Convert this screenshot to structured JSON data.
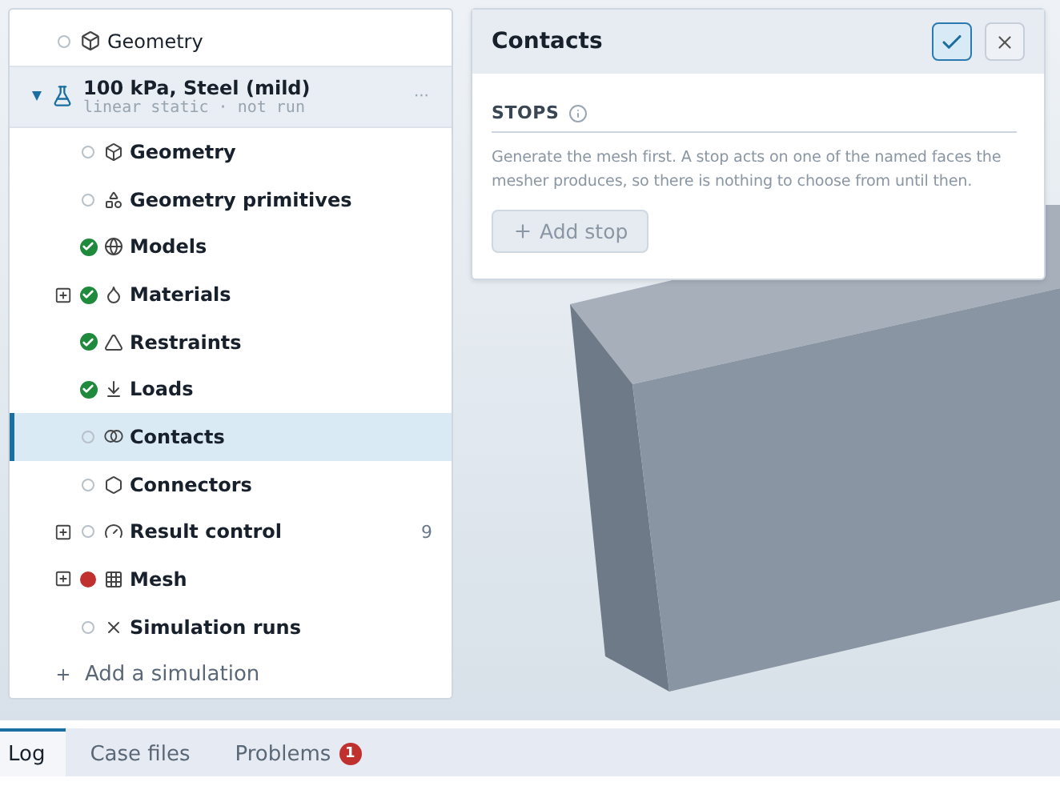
{
  "tree": {
    "top_items": [
      {
        "label": "Geometry",
        "complete": false,
        "failed": false
      }
    ],
    "simulation": {
      "title": "100 kPa, Steel (mild)",
      "subtitle": "linear static · not run",
      "expanded": true,
      "menu": "···",
      "children": [
        {
          "label": "Geometry",
          "complete": false,
          "failed": false,
          "expandable": false,
          "selected": false
        },
        {
          "label": "Geometry primitives",
          "complete": false,
          "failed": false,
          "expandable": false,
          "selected": false
        },
        {
          "label": "Models",
          "complete": true,
          "failed": false,
          "expandable": false,
          "selected": false
        },
        {
          "label": "Materials",
          "complete": true,
          "failed": false,
          "expandable": true,
          "selected": false
        },
        {
          "label": "Restraints",
          "complete": true,
          "failed": false,
          "expandable": false,
          "selected": false
        },
        {
          "label": "Loads",
          "complete": true,
          "failed": false,
          "expandable": false,
          "selected": false
        },
        {
          "label": "Contacts",
          "complete": false,
          "failed": false,
          "expandable": false,
          "selected": true
        },
        {
          "label": "Connectors",
          "complete": false,
          "failed": false,
          "expandable": false,
          "selected": false
        },
        {
          "label": "Result control",
          "complete": false,
          "failed": false,
          "expandable": true,
          "selected": false,
          "count": "9"
        },
        {
          "label": "Mesh",
          "complete": false,
          "failed": true,
          "expandable": true,
          "selected": false
        },
        {
          "label": "Simulation runs",
          "complete": false,
          "failed": false,
          "expandable": false,
          "selected": false
        }
      ]
    },
    "add_label": "Add a simulation"
  },
  "panel": {
    "title": "Contacts",
    "section": "STOPS",
    "description": "Generate the mesh first. A stop acts on one of the named faces the mesher produces, so there is nothing to choose from until then.",
    "add_button": {
      "label": "Add stop",
      "disabled": true
    }
  },
  "bottom_tabs": [
    {
      "label": "Log",
      "selected": true
    },
    {
      "label": "Case files",
      "selected": false
    },
    {
      "label": "Problems",
      "selected": false,
      "badge": "1"
    }
  ]
}
